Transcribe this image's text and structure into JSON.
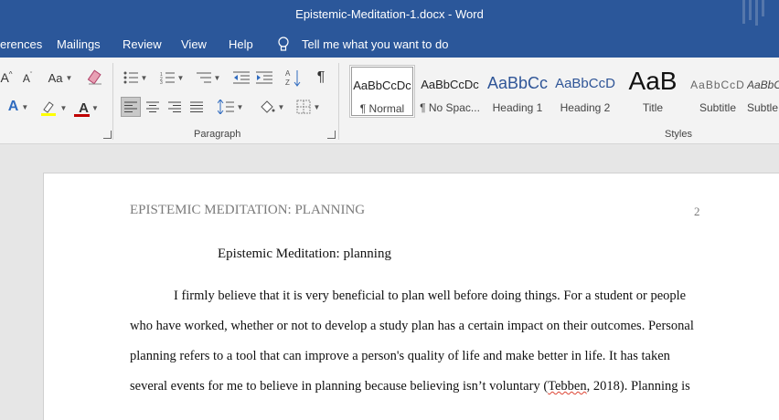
{
  "window": {
    "title": "Epistemic-Meditation-1.docx  -  Word"
  },
  "tabs": [
    "erences",
    "Mailings",
    "Review",
    "View",
    "Help"
  ],
  "tell_me": "Tell me what you want to do",
  "ribbon": {
    "font_group": {
      "grow_font": "A",
      "shrink_font": "A",
      "change_case": "Aa",
      "text_effects": "A",
      "font_color": "A",
      "font_color_value": "#c00000",
      "highlight_color_value": "#ffff00"
    },
    "paragraph_group": {
      "label": "Paragraph",
      "pilcrow": "¶"
    },
    "styles_group": {
      "label": "Styles",
      "styles": [
        {
          "preview": "AaBbCcDc",
          "name": "¶ Normal"
        },
        {
          "preview": "AaBbCcDc",
          "name": "¶ No Spac..."
        },
        {
          "preview": "AaBbCc",
          "name": "Heading 1"
        },
        {
          "preview": "AaBbCcD",
          "name": "Heading 2"
        },
        {
          "preview": "AaB",
          "name": "Title"
        },
        {
          "preview": "AaBbCcD",
          "name": "Subtitle"
        },
        {
          "preview": "AaBbCcD",
          "name": "Subtle"
        }
      ]
    }
  },
  "document": {
    "header": "EPISTEMIC MEDITATION: PLANNING",
    "page_number": "2",
    "title": "Epistemic Meditation: planning",
    "lines": [
      "I firmly believe that it is very beneficial to plan well before doing things. For a student or people",
      "who have worked, whether or not to develop a study plan has a certain impact on their outcomes. Personal",
      "planning refers to a tool that can improve a person's quality of life and make better in life. It has taken"
    ],
    "line4_before": "several events for me to believe in planning because believing isn’t voluntary (",
    "line4_misspelled": "Tebben",
    "line4_after": ", 2018). Planning is"
  }
}
